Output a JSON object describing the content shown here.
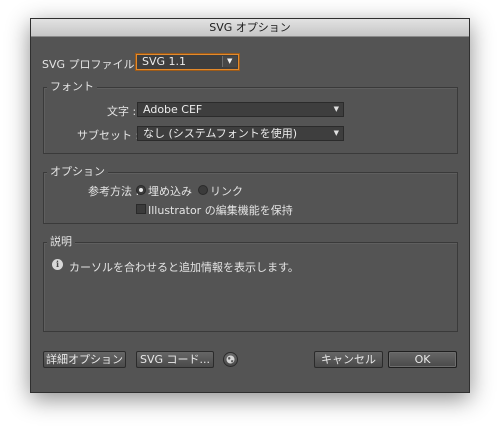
{
  "dialog": {
    "title": "SVG オプション"
  },
  "profile": {
    "label": "SVG プロファイル :",
    "value": "SVG 1.1"
  },
  "font_group": {
    "title": "フォント",
    "type_label": "文字 :",
    "type_value": "Adobe CEF",
    "subset_label": "サブセット :",
    "subset_value": "なし (システムフォントを使用)"
  },
  "options_group": {
    "title": "オプション",
    "method_label": "参考方法 :",
    "embed_label": "埋め込み",
    "embed_checked": true,
    "link_label": "リンク",
    "link_checked": false,
    "preserve_label": "Illustrator の編集機能を保持",
    "preserve_checked": false
  },
  "description_group": {
    "title": "説明",
    "text": "カーソルを合わせると追加情報を表示します。"
  },
  "buttons": {
    "advanced": "詳細オプション",
    "svg_code": "SVG コード...",
    "cancel": "キャンセル",
    "ok": "OK"
  },
  "icons": {
    "info": "info-icon",
    "globe": "globe-icon",
    "dropdown": "dropdown-arrow-icon"
  }
}
